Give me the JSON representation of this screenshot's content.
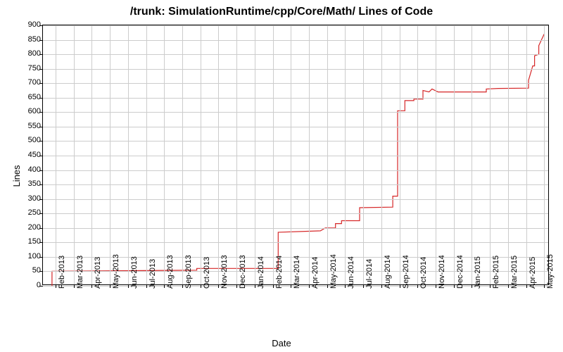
{
  "chart_data": {
    "type": "line",
    "title": "/trunk: SimulationRuntime/cpp/Core/Math/ Lines of Code",
    "xlabel": "Date",
    "ylabel": "Lines",
    "ylim": [
      0,
      900
    ],
    "yticks": [
      0,
      50,
      100,
      150,
      200,
      250,
      300,
      350,
      400,
      450,
      500,
      550,
      600,
      650,
      700,
      750,
      800,
      850,
      900
    ],
    "xticks": [
      "Feb-2013",
      "Mar-2013",
      "Apr-2013",
      "May-2013",
      "Jun-2013",
      "Jul-2013",
      "Aug-2013",
      "Sep-2013",
      "Oct-2013",
      "Nov-2013",
      "Dec-2013",
      "Jan-2014",
      "Feb-2014",
      "Mar-2014",
      "Apr-2014",
      "May-2014",
      "Jun-2014",
      "Jul-2014",
      "Aug-2014",
      "Sep-2014",
      "Oct-2014",
      "Nov-2014",
      "Dec-2014",
      "Jan-2015",
      "Feb-2015",
      "Mar-2015",
      "Apr-2015",
      "May-2015"
    ],
    "series": [
      {
        "name": "Lines of Code",
        "color": "#d62728",
        "points": [
          {
            "x": "2013-01-25",
            "y": 0
          },
          {
            "x": "2013-01-25",
            "y": 50
          },
          {
            "x": "2013-05-15",
            "y": 52
          },
          {
            "x": "2013-09-25",
            "y": 54
          },
          {
            "x": "2013-09-25",
            "y": 60
          },
          {
            "x": "2014-02-10",
            "y": 60
          },
          {
            "x": "2014-02-10",
            "y": 185
          },
          {
            "x": "2014-04-20",
            "y": 190
          },
          {
            "x": "2014-04-28",
            "y": 200
          },
          {
            "x": "2014-05-15",
            "y": 200
          },
          {
            "x": "2014-05-15",
            "y": 215
          },
          {
            "x": "2014-05-25",
            "y": 215
          },
          {
            "x": "2014-05-25",
            "y": 225
          },
          {
            "x": "2014-06-25",
            "y": 225
          },
          {
            "x": "2014-06-25",
            "y": 270
          },
          {
            "x": "2014-08-20",
            "y": 272
          },
          {
            "x": "2014-08-20",
            "y": 310
          },
          {
            "x": "2014-08-28",
            "y": 310
          },
          {
            "x": "2014-08-28",
            "y": 605
          },
          {
            "x": "2014-09-10",
            "y": 605
          },
          {
            "x": "2014-09-10",
            "y": 640
          },
          {
            "x": "2014-09-25",
            "y": 640
          },
          {
            "x": "2014-09-25",
            "y": 645
          },
          {
            "x": "2014-10-10",
            "y": 645
          },
          {
            "x": "2014-10-10",
            "y": 675
          },
          {
            "x": "2014-10-20",
            "y": 670
          },
          {
            "x": "2014-10-25",
            "y": 680
          },
          {
            "x": "2014-11-05",
            "y": 670
          },
          {
            "x": "2015-01-25",
            "y": 670
          },
          {
            "x": "2015-01-25",
            "y": 680
          },
          {
            "x": "2015-02-15",
            "y": 682
          },
          {
            "x": "2015-04-05",
            "y": 683
          },
          {
            "x": "2015-04-05",
            "y": 710
          },
          {
            "x": "2015-04-12",
            "y": 760
          },
          {
            "x": "2015-04-15",
            "y": 760
          },
          {
            "x": "2015-04-15",
            "y": 795
          },
          {
            "x": "2015-04-22",
            "y": 800
          },
          {
            "x": "2015-04-22",
            "y": 830
          },
          {
            "x": "2015-05-01",
            "y": 870
          }
        ]
      }
    ]
  }
}
